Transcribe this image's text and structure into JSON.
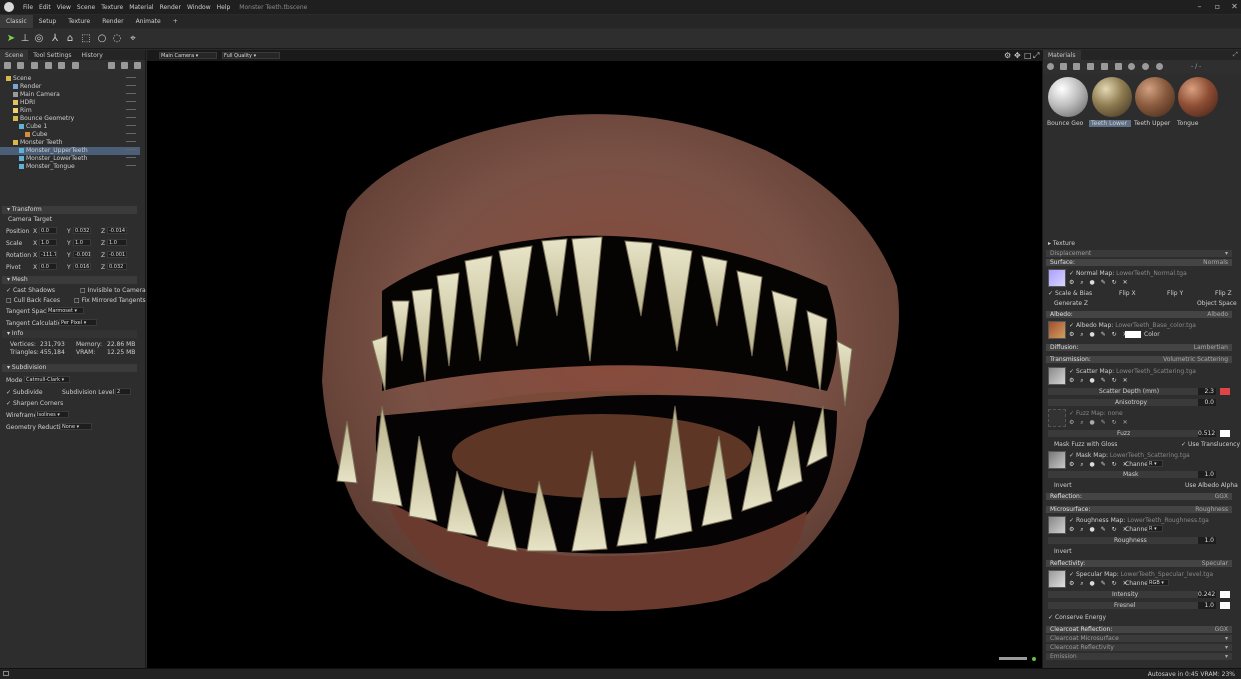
{
  "app": {
    "title": "Monster Teeth.tbscene",
    "menu": [
      "File",
      "Edit",
      "View",
      "Scene",
      "Texture",
      "Material",
      "Render",
      "Window",
      "Help"
    ]
  },
  "modes": [
    "Classic",
    "Setup",
    "Texture",
    "Render",
    "Animate",
    "+"
  ],
  "left": {
    "tabs": [
      "Scene",
      "Tool Settings",
      "History"
    ],
    "tree": [
      {
        "label": "Scene",
        "depth": 0
      },
      {
        "label": "Render",
        "depth": 1
      },
      {
        "label": "Main Camera",
        "depth": 1
      },
      {
        "label": "HDRI",
        "depth": 1
      },
      {
        "label": "Rim",
        "depth": 1
      },
      {
        "label": "Bounce Geometry",
        "depth": 1
      },
      {
        "label": "Cube 1",
        "depth": 2
      },
      {
        "label": "Cube",
        "depth": 3
      },
      {
        "label": "Monster Teeth",
        "depth": 1
      },
      {
        "label": "Monster_UpperTeeth",
        "depth": 2,
        "selected": true
      },
      {
        "label": "Monster_LowerTeeth",
        "depth": 2
      },
      {
        "label": "Monster_Tongue",
        "depth": 2
      }
    ],
    "transform": {
      "title": "Transform",
      "camera_target": "Camera Target",
      "position": {
        "label": "Position",
        "x": "0.0",
        "y": "0.032",
        "z": "-0.014"
      },
      "scale": {
        "label": "Scale",
        "x": "1.0",
        "y": "1.0",
        "z": "1.0"
      },
      "rotation": {
        "label": "Rotation",
        "x": "-111.7",
        "y": "-0.001",
        "z": "-0.001"
      },
      "pivot": {
        "label": "Pivot",
        "x": "0.0",
        "y": "0.016",
        "z": "0.032"
      }
    },
    "mesh": {
      "title": "Mesh",
      "cast_shadows": "Cast Shadows",
      "invisible": "Invisible to Camera",
      "cull": "Cull Back Faces",
      "fix_mirrored": "Fix Mirrored Tangents",
      "tangent_space_label": "Tangent Space",
      "tangent_space": "Marmoset",
      "tangent_calc_label": "Tangent Calculation",
      "tangent_calc": "Per Pixel"
    },
    "info": {
      "title": "Info",
      "vertices_label": "Vertices:",
      "vertices": "231,793",
      "memory_label": "Memory:",
      "memory": "22.86 MB",
      "triangles_label": "Triangles:",
      "triangles": "455,184",
      "vram_label": "VRAM:",
      "vram": "12.25 MB"
    },
    "subdivision": {
      "title": "Subdivision",
      "mode_label": "Mode",
      "mode": "Catmull-Clark",
      "subdivide": "Subdivide",
      "level_label": "Subdivision Level",
      "level": "2",
      "sharpen": "Sharpen Corners",
      "wireframe_label": "Wireframe",
      "wireframe": "Isolines",
      "geo_label": "Geometry Reduction",
      "geo": "None"
    }
  },
  "viewport": {
    "camera": "Main Camera",
    "quality": "Full Quality"
  },
  "right": {
    "title": "Materials",
    "path": "- / -",
    "swatches": [
      {
        "label": "Bounce Geo"
      },
      {
        "label": "Teeth Lower",
        "selected": true
      },
      {
        "label": "Teeth Upper"
      },
      {
        "label": "Tongue"
      }
    ],
    "texture": "Texture",
    "displacement": "Displacement",
    "surface": {
      "title": "Surface:",
      "type": "Normals",
      "map": "Normal Map:",
      "file": "LowerTeeth_Normal.tga",
      "scale_bias": "Scale & Bias",
      "flipx": "Flip X",
      "flipy": "Flip Y",
      "flipz": "Flip Z",
      "genz": "Generate Z",
      "object_space": "Object Space"
    },
    "albedo": {
      "title": "Albedo:",
      "type": "Albedo",
      "map": "Albedo Map:",
      "file": "LowerTeeth_Base_color.tga",
      "color": "Color"
    },
    "diffusion": {
      "title": "Diffusion:",
      "type": "Lambertian"
    },
    "transmission": {
      "title": "Transmission:",
      "type": "Volumetric Scattering",
      "map": "Scatter Map:",
      "file": "LowerTeeth_Scattering.tga",
      "depth_label": "Scatter Depth (mm)",
      "depth": "2.3",
      "aniso_label": "Anisotropy",
      "aniso": "0.0",
      "fuzz_map": "Fuzz Map:",
      "fuzz_file": "none",
      "fuzz_label": "Fuzz",
      "fuzz": "0.512",
      "mask_fuzz": "Mask Fuzz with Gloss",
      "use_transl": "Use Translucency",
      "mask_map": "Mask Map:",
      "mask_file": "LowerTeeth_Scattering.tga",
      "channel": "Channel",
      "channel_val": "R",
      "mask_label": "Mask",
      "mask": "1.0",
      "invert": "Invert",
      "use_alpha": "Use Albedo Alpha"
    },
    "reflection": {
      "title": "Reflection:",
      "type": "GGX"
    },
    "microsurface": {
      "title": "Microsurface:",
      "type": "Roughness",
      "map": "Roughness Map:",
      "file": "LowerTeeth_Roughness.tga",
      "channel": "Channel",
      "channel_val": "R",
      "rough_label": "Roughness",
      "rough": "1.0",
      "invert": "Invert"
    },
    "reflectivity": {
      "title": "Reflectivity:",
      "type": "Specular",
      "map": "Specular Map:",
      "file": "LowerTeeth_Specular_level.tga",
      "channel": "Channel",
      "channel_val": "RGB",
      "int_label": "Intensity",
      "int": "0.242",
      "fres_label": "Fresnel",
      "fres": "1.0",
      "conserve": "Conserve Energy"
    },
    "clearcoat": {
      "title": "Clearcoat Reflection:",
      "type": "GGX",
      "micro": "Clearcoat Microsurface",
      "refl": "Clearcoat Reflectivity",
      "emission": "Emission"
    }
  },
  "status": {
    "text": "Autosave in 0:45   VRAM: 23%"
  }
}
